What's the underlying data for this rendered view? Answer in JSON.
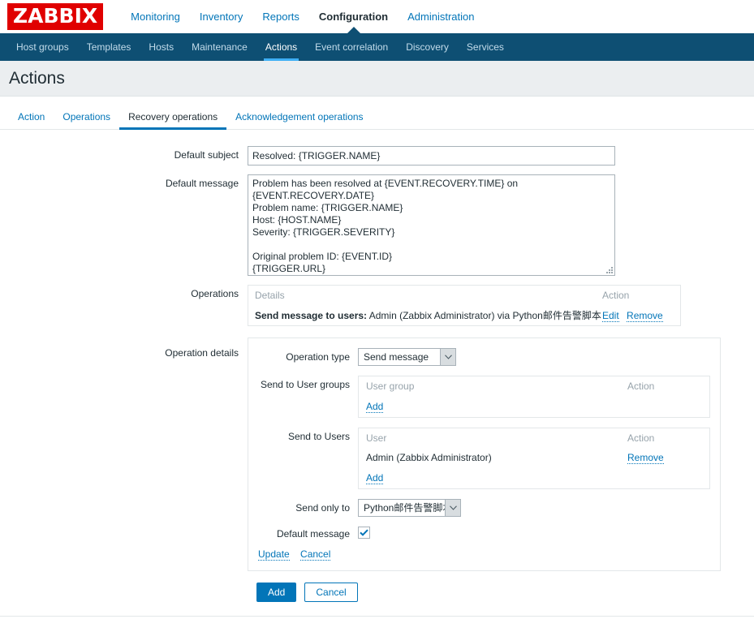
{
  "brand": {
    "logo_text": "ZABBIX",
    "logo_bg": "#e00000",
    "accent": "#0275b8",
    "nav_bg": "#0e4f73",
    "nav_active_underline": "#3eaff5"
  },
  "main_menu": [
    {
      "label": "Monitoring",
      "selected": false
    },
    {
      "label": "Inventory",
      "selected": false
    },
    {
      "label": "Reports",
      "selected": false
    },
    {
      "label": "Configuration",
      "selected": true
    },
    {
      "label": "Administration",
      "selected": false
    }
  ],
  "sub_menu": [
    {
      "label": "Host groups",
      "selected": false
    },
    {
      "label": "Templates",
      "selected": false
    },
    {
      "label": "Hosts",
      "selected": false
    },
    {
      "label": "Maintenance",
      "selected": false
    },
    {
      "label": "Actions",
      "selected": true
    },
    {
      "label": "Event correlation",
      "selected": false
    },
    {
      "label": "Discovery",
      "selected": false
    },
    {
      "label": "Services",
      "selected": false
    }
  ],
  "page": {
    "title": "Actions"
  },
  "tabs": [
    {
      "label": "Action",
      "selected": false
    },
    {
      "label": "Operations",
      "selected": false
    },
    {
      "label": "Recovery operations",
      "selected": true
    },
    {
      "label": "Acknowledgement operations",
      "selected": false
    }
  ],
  "form": {
    "default_subject": {
      "label": "Default subject",
      "value": "Resolved: {TRIGGER.NAME}",
      "placeholder": ""
    },
    "default_message": {
      "label": "Default message",
      "value": "Problem has been resolved at {EVENT.RECOVERY.TIME} on {EVENT.RECOVERY.DATE}\nProblem name: {TRIGGER.NAME}\nHost: {HOST.NAME}\nSeverity: {TRIGGER.SEVERITY}\n\nOriginal problem ID: {EVENT.ID}\n{TRIGGER.URL}",
      "placeholder": ""
    },
    "operations": {
      "label": "Operations",
      "columns": {
        "details": "Details",
        "action": "Action"
      },
      "rows": [
        {
          "details_bold": "Send message to users:",
          "details_rest": " Admin (Zabbix Administrator) via Python邮件告警脚本",
          "edit": "Edit",
          "remove": "Remove"
        }
      ]
    },
    "operation_details": {
      "label": "Operation details",
      "operation_type": {
        "label": "Operation type",
        "value": "Send message",
        "options": [
          "Send message"
        ]
      },
      "send_to_user_groups": {
        "label": "Send to User groups",
        "columns": {
          "group": "User group",
          "action": "Action"
        },
        "rows": [],
        "add": "Add"
      },
      "send_to_users": {
        "label": "Send to Users",
        "columns": {
          "user": "User",
          "action": "Action"
        },
        "rows": [
          {
            "user": "Admin (Zabbix Administrator)",
            "action": "Remove"
          }
        ],
        "add": "Add"
      },
      "send_only_to": {
        "label": "Send only to",
        "value": "Python邮件告警脚本",
        "options": [
          "Python邮件告警脚本"
        ]
      },
      "default_message_checkbox": {
        "label": "Default message",
        "checked": true
      },
      "update_label": "Update",
      "cancel_label": "Cancel"
    },
    "footer": {
      "add_label": "Add",
      "cancel_label": "Cancel"
    }
  }
}
